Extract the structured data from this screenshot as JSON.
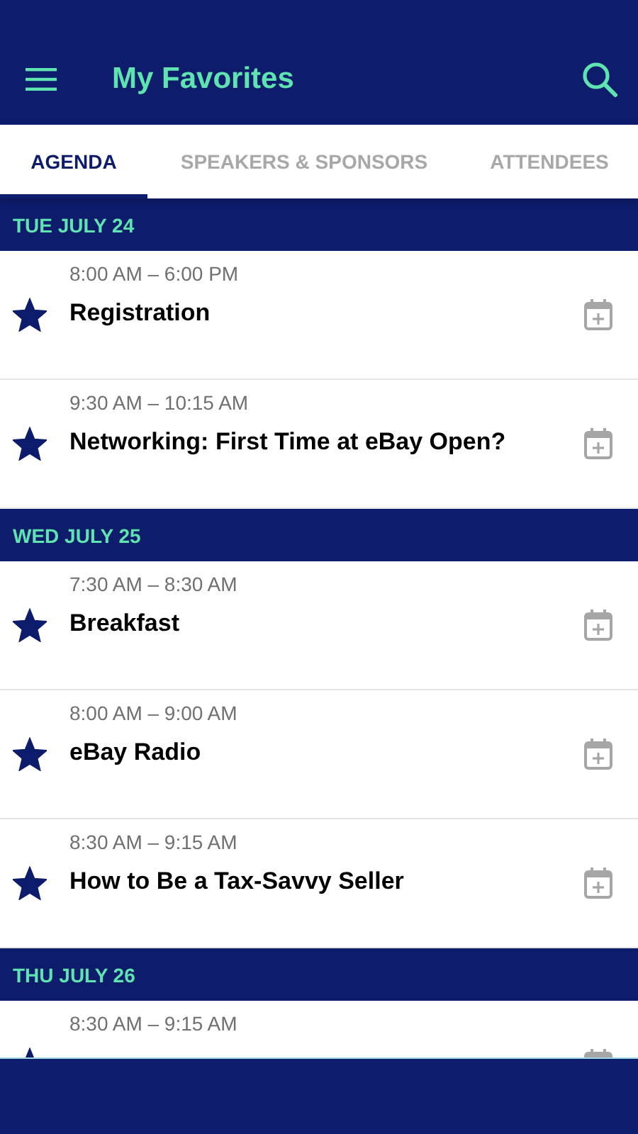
{
  "header": {
    "title": "My Favorites"
  },
  "tabs": [
    {
      "label": "AGENDA",
      "selected": true
    },
    {
      "label": "SPEAKERS & SPONSORS",
      "selected": false
    },
    {
      "label": "ATTENDEES",
      "selected": false
    }
  ],
  "days": [
    {
      "label": "TUE JULY 24",
      "sessions": [
        {
          "time": "8:00 AM – 6:00 PM",
          "title": "Registration",
          "starred": true
        },
        {
          "time": "9:30 AM – 10:15 AM",
          "title": "Networking: First Time at eBay Open?",
          "starred": true
        }
      ]
    },
    {
      "label": "WED JULY 25",
      "sessions": [
        {
          "time": "7:30 AM – 8:30 AM",
          "title": "Breakfast",
          "starred": true
        },
        {
          "time": "8:00 AM – 9:00 AM",
          "title": "eBay Radio",
          "starred": true
        },
        {
          "time": "8:30 AM – 9:15 AM",
          "title": "How to Be a Tax-Savvy Seller",
          "starred": true
        }
      ]
    },
    {
      "label": "THU JULY 26",
      "sessions": [
        {
          "time": "8:30 AM – 9:15 AM",
          "starred": true
        }
      ]
    }
  ]
}
